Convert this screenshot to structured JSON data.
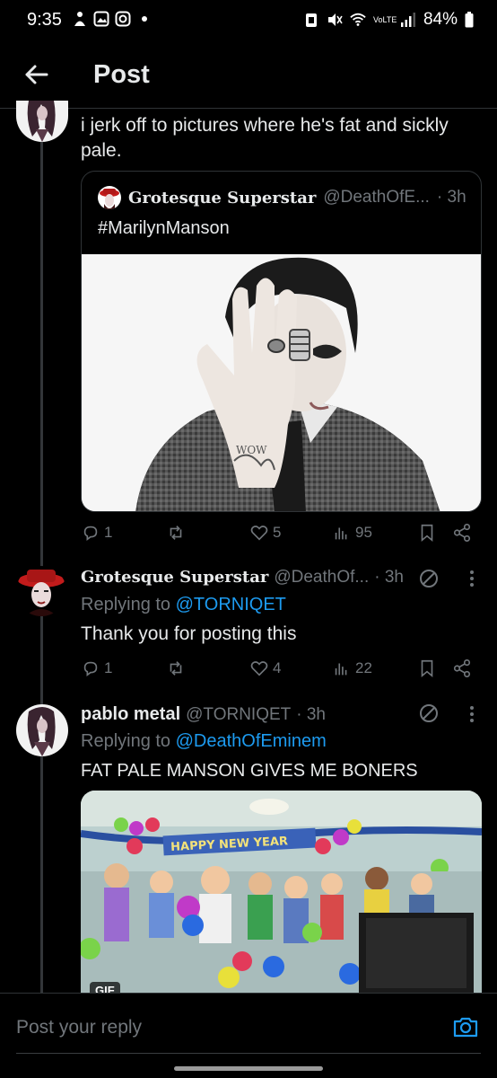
{
  "status_bar": {
    "time": "9:35",
    "battery": "84%",
    "network": "VoLTE"
  },
  "header": {
    "title": "Post"
  },
  "main_post": {
    "text": "i jerk off to pictures where he's fat and sickly pale.",
    "quote": {
      "name": "Grotesque Superstar",
      "handle": "@DeathOfE...",
      "time": "· 3h",
      "text": "#MarilynManson",
      "image_label": "WOW"
    },
    "actions": {
      "replies": "1",
      "reposts": "",
      "likes": "5",
      "views": "95"
    }
  },
  "reply_1": {
    "name": "Grotesque Superstar",
    "handle": "@DeathOf...",
    "time": "· 3h",
    "replying_prefix": "Replying to ",
    "replying_to": "@TORNIQET",
    "text": "Thank you for posting this",
    "actions": {
      "replies": "1",
      "reposts": "",
      "likes": "4",
      "views": "22"
    }
  },
  "reply_2": {
    "name": "pablo metal",
    "handle": "@TORNIQET",
    "time": "· 3h",
    "replying_prefix": "Replying to ",
    "replying_to": "@DeathOfEminem",
    "text": "FAT PALE MANSON GIVES ME BONERS",
    "gif_banner": "HAPPY NEW YEAR",
    "gif_badge": "GIF"
  },
  "reply_bar": {
    "placeholder": "Post your reply"
  },
  "colors": {
    "background": "#000000",
    "text": "#e7e9ea",
    "muted": "#71767b",
    "link": "#1d9bf0"
  }
}
